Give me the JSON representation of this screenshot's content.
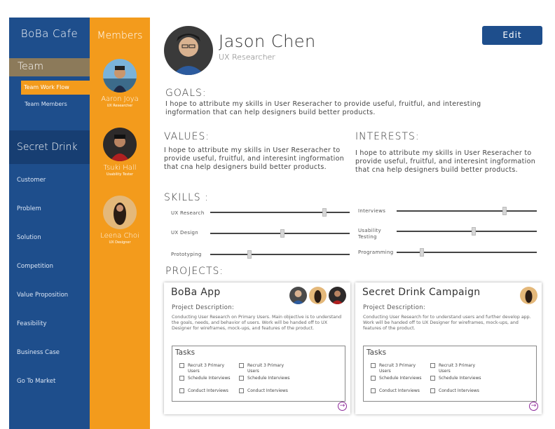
{
  "sidebar": {
    "brand": "BoBa Cafe",
    "team_label": "Team",
    "team_items": [
      "Team Work Flow",
      "Team Members"
    ],
    "section_label": "Secret Drink",
    "items": [
      "Customer",
      "Problem",
      "Solution",
      "Competition",
      "Value Proposition",
      "Feasibility",
      "Business Case",
      "Go To Market"
    ]
  },
  "members": {
    "title": "Members",
    "list": [
      {
        "name": "Aaron Joya",
        "role": "UX Researcher"
      },
      {
        "name": "Tsuki Hall",
        "role": "Usability Tester"
      },
      {
        "name": "Leena Choi",
        "role": "UX Designer"
      }
    ]
  },
  "profile": {
    "name": "Jason Chen",
    "role": "UX Researcher",
    "edit_label": "Edit"
  },
  "goals": {
    "heading": "GOALS:",
    "text": "I hope to attribute my skills in User Reseracher to provide useful, fruitful, and interesting ingformation that can help designers build better products."
  },
  "values": {
    "heading": "VALUES:",
    "text": "I hope to attribute my skills in User Reseracher to provide useful, fruitful, and interesint ingformation that cna help designers  build better products."
  },
  "interests": {
    "heading": "INTERESTS:",
    "text": "I hope to attribute my skills in User Reseracher to provide useful, fruitful, and interesint ingformation that cna help designers  build better products."
  },
  "skills": {
    "heading": "SKILLS :",
    "left": [
      {
        "label": "UX Research",
        "level": 0.82
      },
      {
        "label": "UX Design",
        "level": 0.52
      },
      {
        "label": "Prototyping",
        "level": 0.28
      }
    ],
    "right": [
      {
        "label": "Interviews",
        "level": 0.77
      },
      {
        "label": "Usability Testing",
        "level": 0.55
      },
      {
        "label": "Programming",
        "level": 0.18
      }
    ]
  },
  "projects": {
    "heading": "PROJECTS:",
    "cards": [
      {
        "title": "BoBa App",
        "subtitle": "Project Description:",
        "description": "Conducting User Research on Primary Users. Main objective is to understand the goals, needs, and behavior of users. Work will be handed off to UX Designer for wireframes, mock-ups, and features of the product.",
        "tasks_title": "Tasks",
        "tasks": [
          "Recruit 3 Primary Users",
          "Recruit 3 Primary Users",
          "Schedule Interviews",
          "Schedule Interviews",
          "Conduct Interviews",
          "Conduct Interviews"
        ]
      },
      {
        "title": "Secret Drink Campaign",
        "subtitle": "Project Description:",
        "description": "Conducting User Research for to understand users and further develop app. Work will be handed off to UX Designer for wireframes, mock-ups, and features of the product.",
        "tasks_title": "Tasks",
        "tasks": [
          "Recruit 3 Primary Users",
          "Recruit 3 Primary Users",
          "Schedule Interviews",
          "Schedule Interviews",
          "Conduct Interviews",
          "Conduct Interviews"
        ]
      }
    ]
  },
  "colors": {
    "sidebar": "#1e4e8c",
    "accent": "#f39b1c",
    "team": "#8c7a5a"
  }
}
